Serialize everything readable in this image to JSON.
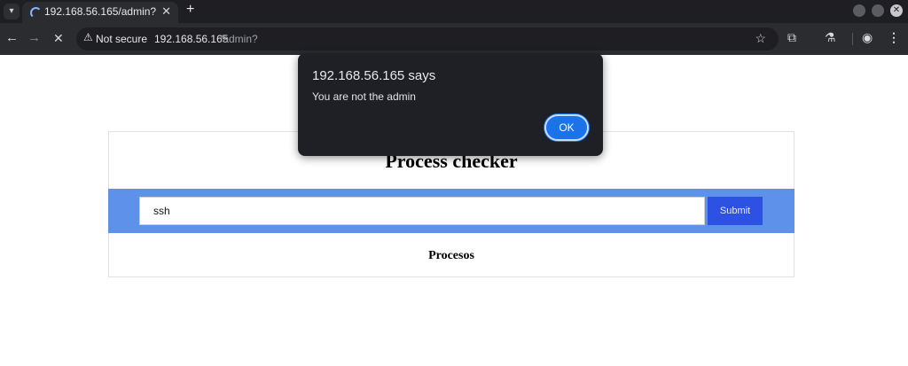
{
  "browser": {
    "tab": {
      "title": "192.168.56.165/admin?",
      "close_glyph": "✕"
    },
    "new_tab_glyph": "+",
    "address_bar": {
      "security_label": "Not secure",
      "url_host": "192.168.56.165",
      "url_path": "/admin?"
    }
  },
  "page": {
    "heading": "Process checker",
    "search": {
      "value": "ssh",
      "submit_label": "Submit"
    },
    "section_heading": "Procesos",
    "colors": {
      "band": "#5e91ea",
      "submit": "#2d52e3"
    }
  },
  "alert": {
    "title": "192.168.56.165 says",
    "message": "You are not the admin",
    "ok_label": "OK"
  },
  "icons": [
    "tab-search-icon",
    "loading-spinner-icon",
    "close-icon",
    "plus-icon",
    "back-arrow-icon",
    "forward-arrow-icon",
    "stop-icon",
    "warning-icon",
    "star-icon",
    "extensions-icon",
    "labs-icon",
    "profile-icon",
    "menu-icon"
  ]
}
